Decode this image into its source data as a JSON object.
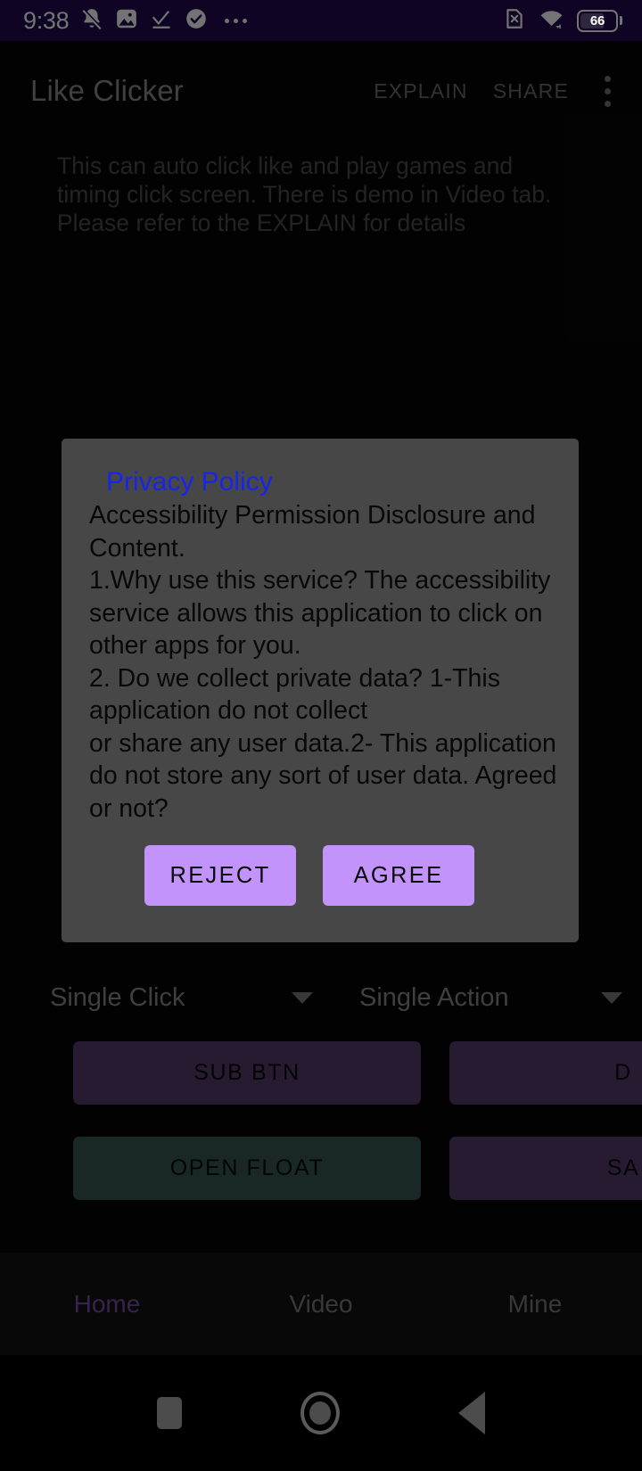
{
  "status_bar": {
    "time": "9:38",
    "left_icons": [
      "bell-mute-icon",
      "photo-icon",
      "check-underline-icon",
      "check-circle-icon",
      "ellipsis-icon"
    ],
    "right_icons": [
      "sim-card-off-icon",
      "wifi-icon"
    ],
    "battery_level": "66",
    "background_color": "#220a4e"
  },
  "app_bar": {
    "title": "Like Clicker",
    "explain_label": "EXPLAIN",
    "share_label": "SHARE",
    "overflow_icon": "more-vertical-icon"
  },
  "description": "This can auto click like and play games and timing click screen. There is demo in Video tab. Please refer to the EXPLAIN for details",
  "dialog": {
    "link_label": "Privacy Policy",
    "body": "Accessibility Permission Disclosure and Content.\n1.Why use this service? The accessibility service allows this application to click on other apps for you.\n2. Do we collect private data? 1-This application do not collect\nor share any user data.2- This application do not store any sort of user data. Agreed or not?",
    "reject_label": "REJECT",
    "agree_label": "AGREE",
    "background_color": "#474747",
    "button_color": "#c293fa",
    "link_color": "#1724ed"
  },
  "spinners": [
    {
      "label": "Single Click",
      "caret_icon": "chevron-down-icon"
    },
    {
      "label": "Single Action",
      "caret_icon": "chevron-down-icon"
    }
  ],
  "action_buttons": [
    {
      "label": "SUB BTN",
      "color": "#543d6d"
    },
    {
      "label": "D",
      "color": "#543d6d"
    },
    {
      "label": "OPEN FLOAT",
      "color": "#395a55"
    },
    {
      "label": "SA",
      "color": "#543d6d"
    }
  ],
  "bottom_nav": {
    "items": [
      {
        "label": "Home",
        "active": true
      },
      {
        "label": "Video",
        "active": false
      },
      {
        "label": "Mine",
        "active": false
      }
    ],
    "active_color": "#7d4fab",
    "inactive_color": "#7d7d7d"
  },
  "system_nav": {
    "recents_icon": "square-recents-icon",
    "home_icon": "circle-home-icon",
    "back_icon": "triangle-back-icon"
  }
}
